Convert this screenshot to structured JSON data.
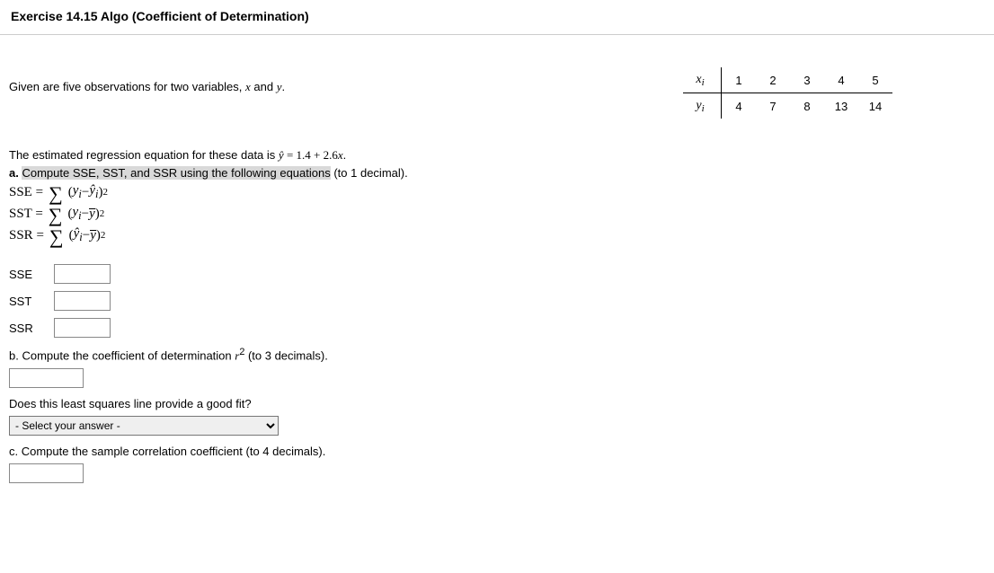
{
  "header": {
    "title": "Exercise 14.15 Algo (Coefficient of Determination)"
  },
  "intro": {
    "text_before": "Given are five observations for two variables, ",
    "var1": "x",
    "text_mid": " and ",
    "var2": "y",
    "text_after": "."
  },
  "data_table": {
    "row1_label": "x",
    "row1_sub": "i",
    "row1": [
      "1",
      "2",
      "3",
      "4",
      "5"
    ],
    "row2_label": "y",
    "row2_sub": "i",
    "row2": [
      "4",
      "7",
      "8",
      "13",
      "14"
    ]
  },
  "regression": {
    "line1_before": "The estimated regression equation for these data is ",
    "line1_eq": "ŷ = 1.4 + 2.6x",
    "line1_after": "."
  },
  "parts": {
    "a_label": "a.",
    "a_highlight": "Compute SSE, SST, and SSR using the following equations",
    "a_after": " (to 1 decimal).",
    "sse_formula_lhs": "SSE =",
    "sst_formula_lhs": "SST =",
    "ssr_formula_lhs": "SSR =",
    "labels": {
      "sse": "SSE",
      "sst": "SST",
      "ssr": "SSR"
    },
    "b_text_before": "b. Compute the coefficient of determination ",
    "b_var": "r",
    "b_sup": "2",
    "b_text_after": " (to 3 decimals).",
    "fit_question": "Does this least squares line provide a good fit?",
    "select_placeholder": "- Select your answer -",
    "c_text": "c. Compute the sample correlation coefficient (to 4 decimals)."
  },
  "inputs": {
    "sse": "",
    "sst": "",
    "ssr": "",
    "r2": "",
    "corr": ""
  }
}
